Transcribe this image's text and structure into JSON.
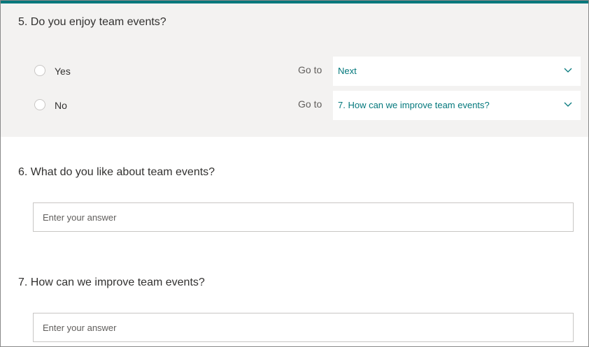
{
  "question5": {
    "title": "5. Do you enjoy team events?",
    "options": [
      {
        "label": "Yes",
        "goto_label": "Go to",
        "goto_value": "Next"
      },
      {
        "label": "No",
        "goto_label": "Go to",
        "goto_value": "7. How can we improve team events?"
      }
    ]
  },
  "question6": {
    "title": "6. What do you like about team events?",
    "placeholder": "Enter your answer"
  },
  "question7": {
    "title": "7. How can we improve team events?",
    "placeholder": "Enter your answer"
  },
  "colors": {
    "accent": "#03787c",
    "selected_section_bg": "#f3f2f1"
  },
  "icons": {
    "dropdown": "chevron-down-icon",
    "option": "radio-button-icon"
  }
}
